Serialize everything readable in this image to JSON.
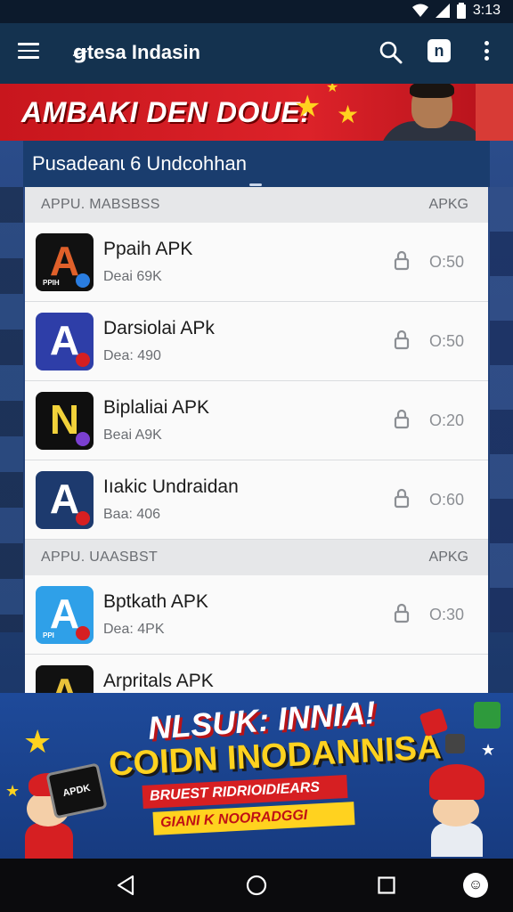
{
  "status_bar": {
    "time": "3:13"
  },
  "app_bar": {
    "title": "ꞡtesa Indasin",
    "nfc_label": "n"
  },
  "promo": {
    "text": "AMBAKI DEN DOUE!"
  },
  "page": {
    "title": "Pusadeanɩ 6 Undcohhan"
  },
  "sections": [
    {
      "title": "APPU. MABSBSS",
      "right": "APKG",
      "rows": [
        {
          "name": "Ppaih APK",
          "sub": "Deai 69K",
          "value": "O:50",
          "glyph": "A",
          "bg": "#111111",
          "fg": "#e0602a",
          "badge": "#2a7de1",
          "mini": "PPIH"
        },
        {
          "name": "Darsiolai APk",
          "sub": "Dea: 490",
          "value": "O:50",
          "glyph": "A",
          "bg": "#2e3ea8",
          "fg": "#ffffff",
          "badge": "#d61f22",
          "mini": ""
        },
        {
          "name": "Biplaliai APK",
          "sub": "Beai A9K",
          "value": "O:20",
          "glyph": "N",
          "bg": "#0f0f0f",
          "fg": "#f2d23a",
          "badge": "#7a3fd1",
          "mini": ""
        },
        {
          "name": "Iıakic Undraidan",
          "sub": "Baa: 406",
          "value": "O:60",
          "glyph": "A",
          "bg": "#1d3a6e",
          "fg": "#ffffff",
          "badge": "#d61f22",
          "mini": ""
        }
      ]
    },
    {
      "title": "APPU. UAASBST",
      "right": "APKG",
      "rows": [
        {
          "name": "Bptkath APK",
          "sub": "Dea: 4PK",
          "value": "O:30",
          "glyph": "A",
          "bg": "#2fa0e8",
          "fg": "#ffffff",
          "badge": "#d61f22",
          "mini": "PPI"
        },
        {
          "name": "Arpritals APK",
          "sub": "",
          "value": "",
          "glyph": "A",
          "bg": "#111111",
          "fg": "#e8c23a",
          "badge": "#3aa04a",
          "mini": ""
        }
      ]
    }
  ],
  "bottom_banner": {
    "line1": "NLSUK: INNIA!",
    "line2": "COIDN INODANNISA",
    "line3": "BRUEST RIDRIOIDIEARS",
    "line4": "GIANI K NOORADGGI",
    "device_label": "APDK"
  },
  "colors": {
    "app_bar": "#14324f",
    "promo_red": "#dc2229",
    "accent_yellow": "#ffd21f"
  }
}
